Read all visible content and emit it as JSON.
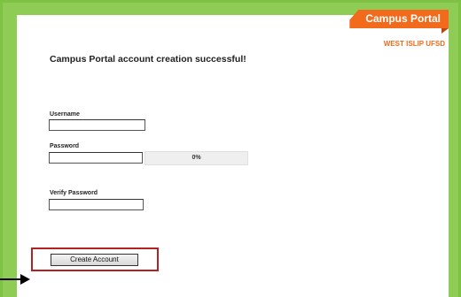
{
  "brand": {
    "tab_label": "Campus Portal",
    "district": "WEST ISLIP UFSD"
  },
  "page": {
    "headline": "Campus Portal account creation successful!"
  },
  "form": {
    "username_label": "Username",
    "username_value": "",
    "password_label": "Password",
    "password_value": "",
    "strength_value": "0%",
    "verify_label": "Verify Password",
    "verify_value": "",
    "submit_label": "Create Account"
  },
  "colors": {
    "frame": "#7dc242",
    "brand_accent": "#f26b1d",
    "highlight": "#b22222"
  },
  "icons": {
    "pointer": "arrow-right-icon"
  }
}
